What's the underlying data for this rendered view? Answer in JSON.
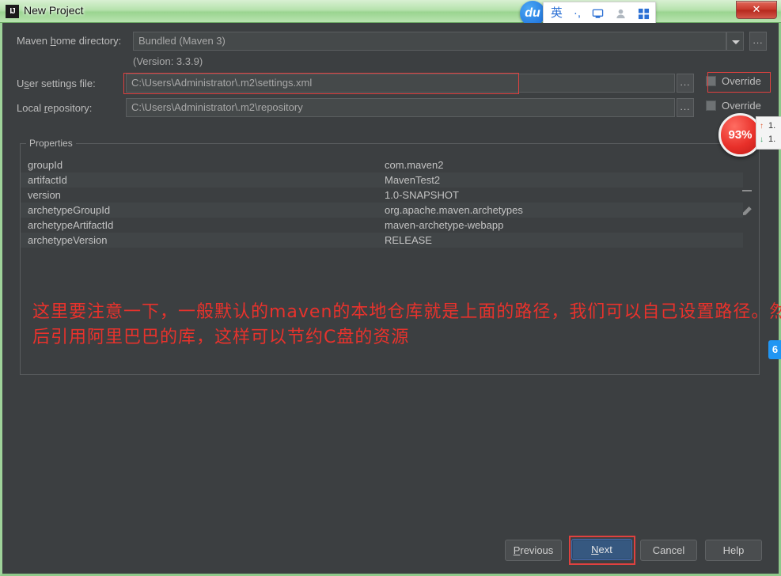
{
  "window": {
    "title": "New Project",
    "app_icon_text": "IJ",
    "close_label": "✕",
    "frame_color": "#9ad490"
  },
  "ime_toolbar": {
    "logo_text": "du",
    "items": [
      {
        "name": "language-mode",
        "label": "英"
      },
      {
        "name": "punctuation-mode",
        "label": "·,"
      },
      {
        "name": "soft-keyboard",
        "label": "keyboard-icon"
      },
      {
        "name": "user-account",
        "label": "person-icon"
      },
      {
        "name": "apps-grid",
        "label": "grid-icon"
      }
    ]
  },
  "form": {
    "maven_home": {
      "label": "Maven home directory:",
      "label_mnemonic": "h",
      "value": "Bundled (Maven 3)",
      "version_note": "(Version: 3.3.9)",
      "browse_label": "..."
    },
    "user_settings": {
      "label": "User settings file:",
      "label_mnemonic": "s",
      "value": "C:\\Users\\Administrator\\.m2\\settings.xml",
      "browse_label": "...",
      "override_label": "Override",
      "override_checked": false
    },
    "local_repository": {
      "label": "Local repository:",
      "label_mnemonic": "r",
      "value": "C:\\Users\\Administrator\\.m2\\repository",
      "browse_label": "...",
      "override_label": "Override",
      "override_checked": false
    }
  },
  "properties": {
    "legend": "Properties",
    "tools": [
      {
        "name": "remove-property-button",
        "icon": "minus-icon"
      },
      {
        "name": "edit-property-button",
        "icon": "pencil-icon"
      }
    ],
    "rows": [
      {
        "key": "groupId",
        "value": "com.maven2"
      },
      {
        "key": "artifactId",
        "value": "MavenTest2"
      },
      {
        "key": "version",
        "value": "1.0-SNAPSHOT"
      },
      {
        "key": "archetypeGroupId",
        "value": "org.apache.maven.archetypes"
      },
      {
        "key": "archetypeArtifactId",
        "value": "maven-archetype-webapp"
      },
      {
        "key": "archetypeVersion",
        "value": "RELEASE"
      }
    ]
  },
  "annotation": {
    "text": "这里要注意一下，一般默认的maven的本地仓库就是上面的路径，我们可以自己设置路径。然后引用阿里巴巴的库，这样可以节约C盘的资源",
    "color": "#e8322c"
  },
  "footer": {
    "buttons": [
      {
        "name": "previous-button",
        "label": "Previous",
        "mnemonic": "P",
        "primary": false
      },
      {
        "name": "next-button",
        "label": "Next",
        "mnemonic": "N",
        "primary": true
      },
      {
        "name": "cancel-button",
        "label": "Cancel",
        "mnemonic": "",
        "primary": false
      },
      {
        "name": "help-button",
        "label": "Help",
        "mnemonic": "",
        "primary": false
      }
    ]
  },
  "overlays": {
    "percent_badge": "93%",
    "network": {
      "up_arrow": "↑",
      "down_arrow": "↓",
      "up_value": "1.",
      "down_value": "1."
    },
    "blue_tab": "6"
  }
}
